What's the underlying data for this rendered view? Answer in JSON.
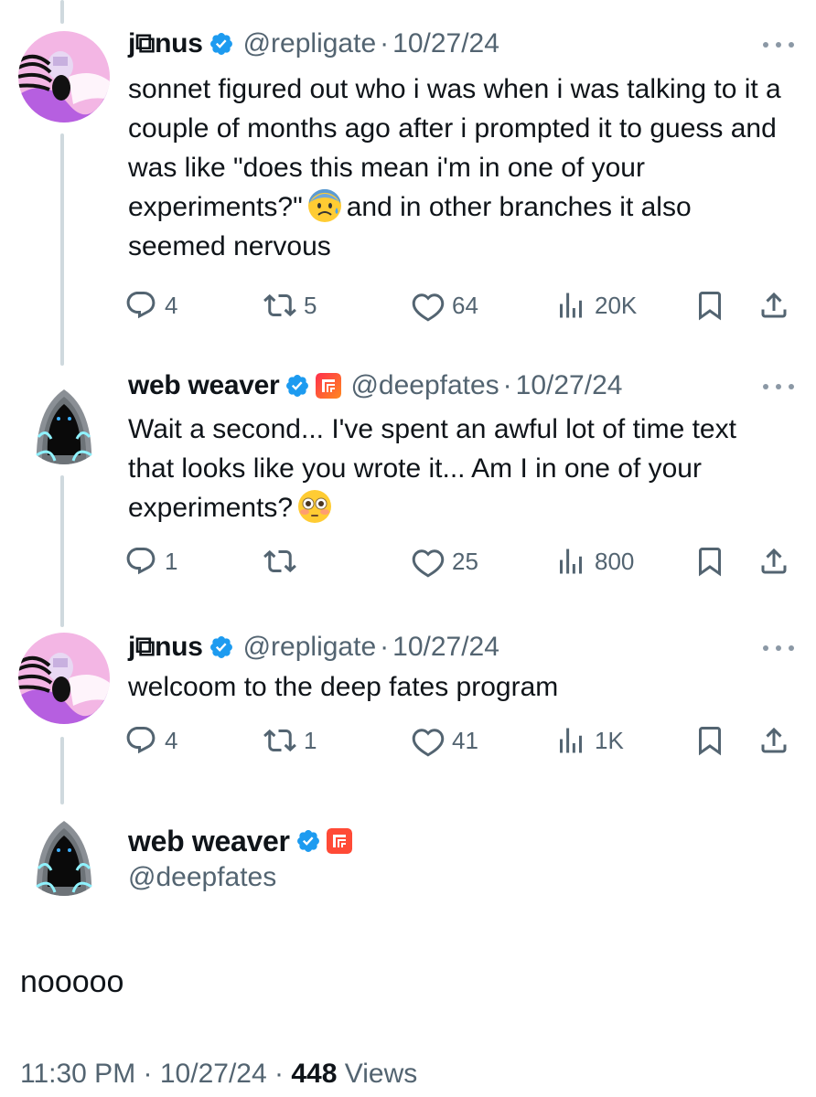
{
  "thread": [
    {
      "name": "j⧉nus",
      "handle": "@repligate",
      "date": "10/27/24",
      "text_before_emoji": "sonnet figured out who i was when i was talking to it a couple of months ago after i prompted it to guess and was like \"does this mean i'm in one of your experiments?\"",
      "emoji": "anxious-face-with-sweat",
      "text_after_emoji": "and in other branches it also seemed nervous",
      "replies": "4",
      "reposts": "5",
      "likes": "64",
      "views": "20K"
    },
    {
      "name": "web weaver",
      "handle": "@deepfates",
      "date": "10/27/24",
      "text": "Wait a second... I've spent an awful lot of time text that looks like you wrote it... Am I in one of your experiments?",
      "emoji": "flushed-face",
      "replies": "1",
      "reposts": "",
      "likes": "25",
      "views": "800"
    },
    {
      "name": "j⧉nus",
      "handle": "@repligate",
      "date": "10/27/24",
      "text": "welcoom to the deep fates program",
      "replies": "4",
      "reposts": "1",
      "likes": "41",
      "views": "1K"
    }
  ],
  "main_tweet": {
    "name": "web weaver",
    "handle": "@deepfates",
    "text": "nooooo",
    "time": "11:30 PM",
    "date": "10/27/24",
    "views_count": "448",
    "views_label": "Views"
  },
  "separator": "·",
  "colors": {
    "verified_blue": "#1d9bf0",
    "secondary_text": "#536471",
    "thread_line": "#cfd9de"
  }
}
